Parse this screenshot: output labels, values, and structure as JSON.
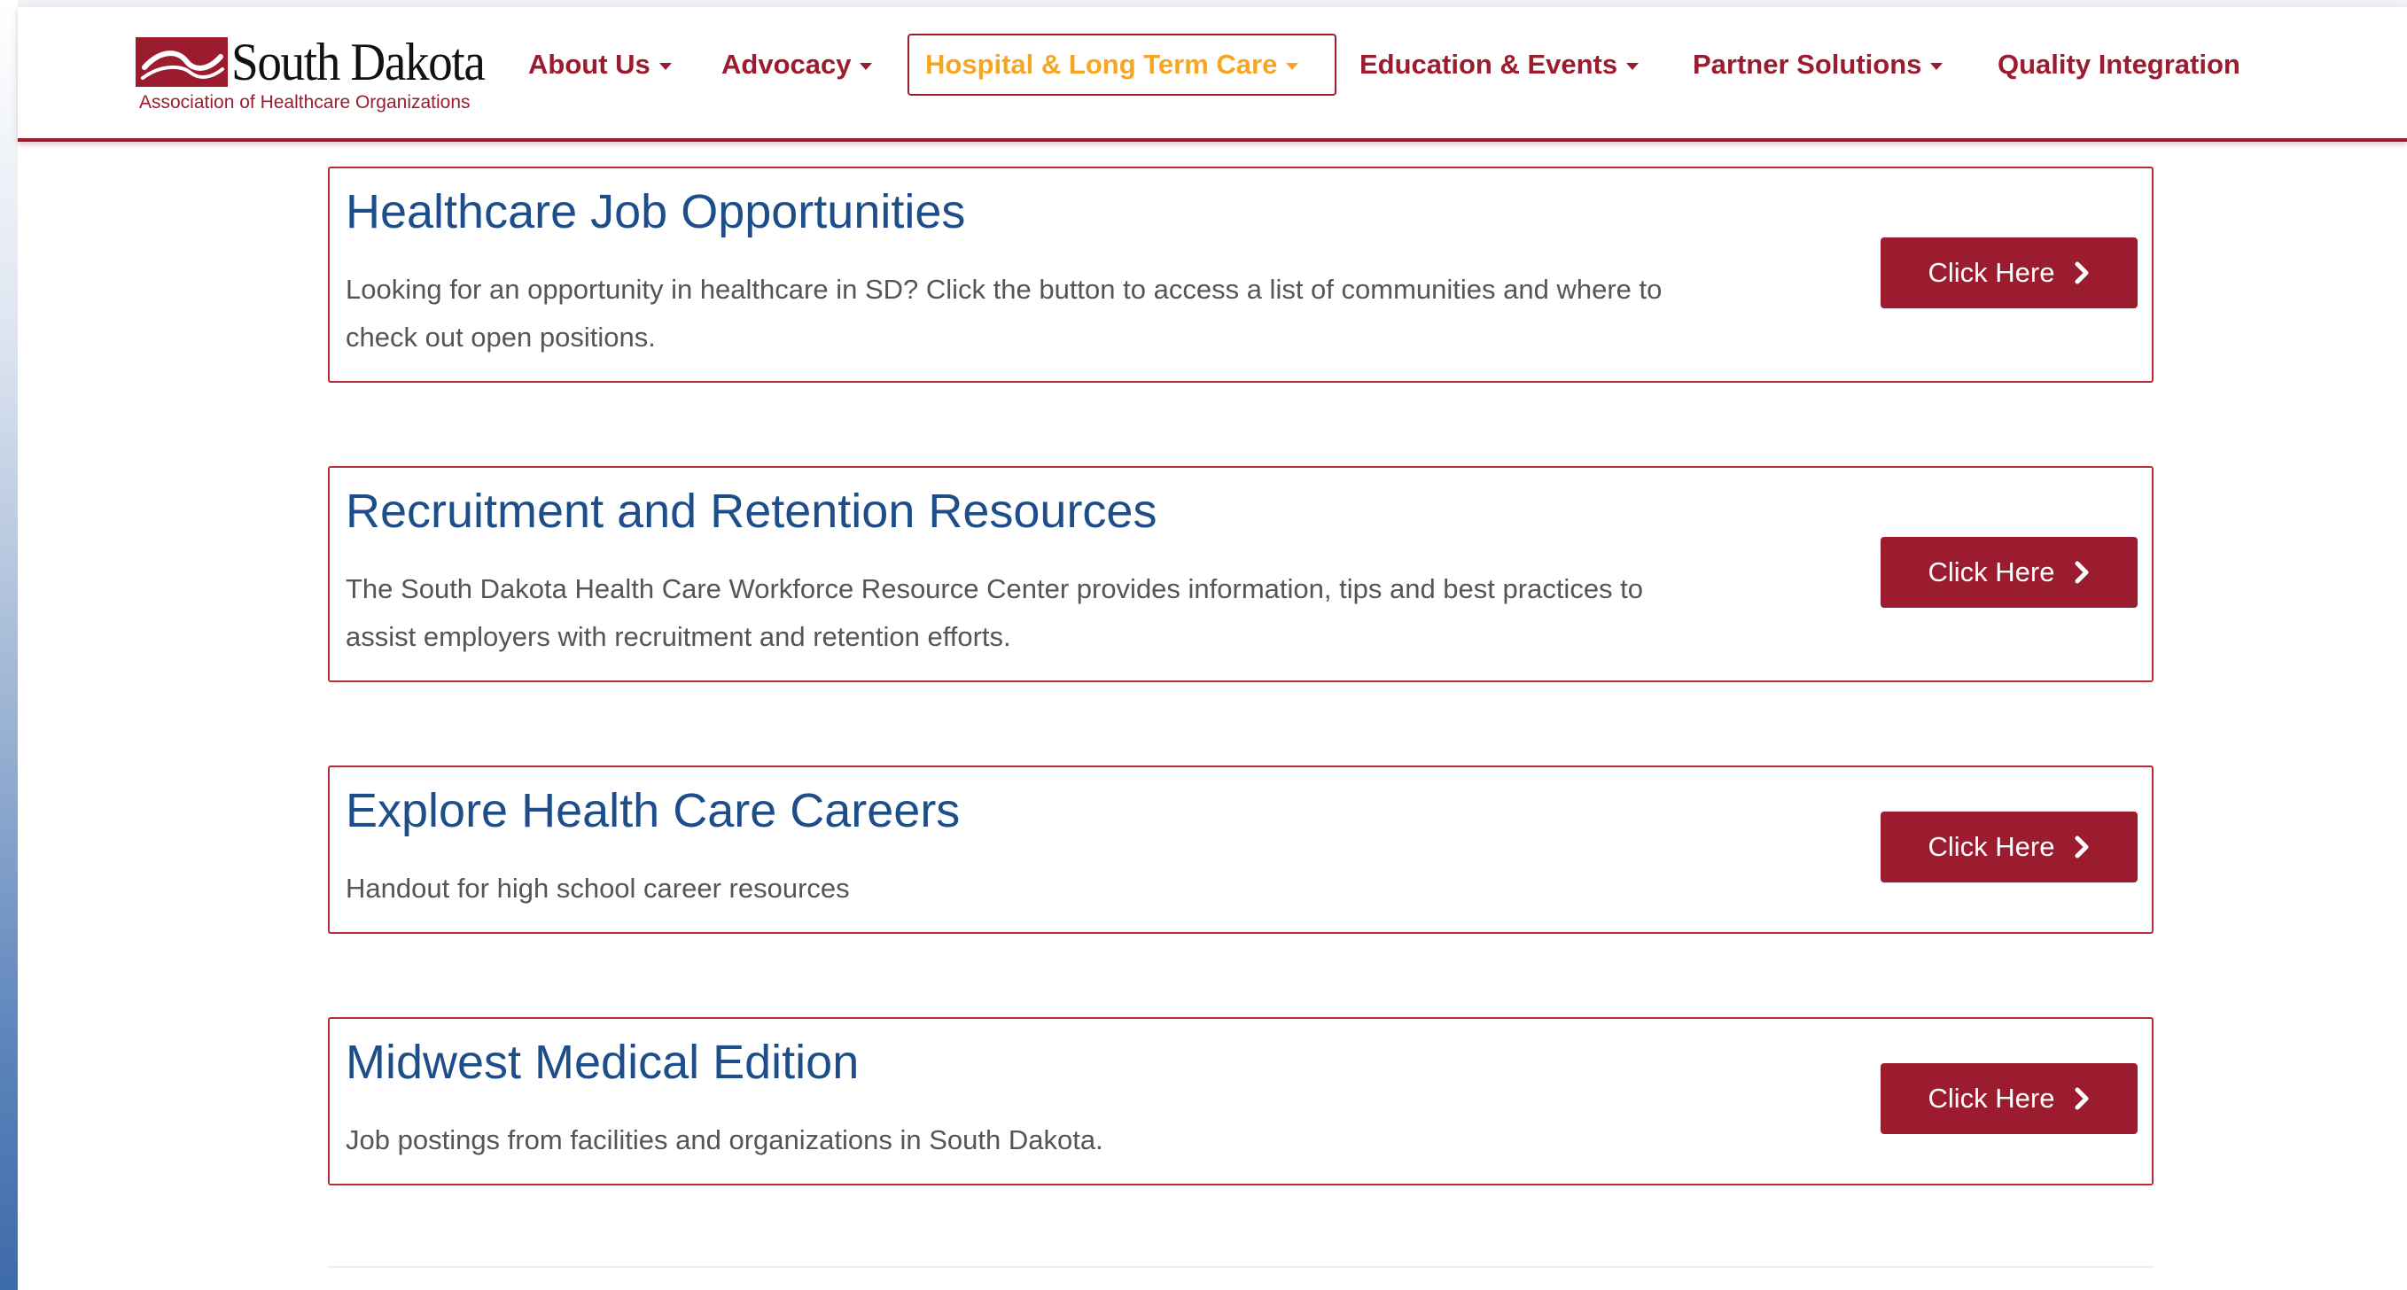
{
  "logo": {
    "name": "South Dakota",
    "subtitle": "Association of Healthcare Organizations"
  },
  "nav": {
    "items": [
      {
        "label": "About Us",
        "has_dropdown": true
      },
      {
        "label": "Advocacy",
        "has_dropdown": true
      },
      {
        "label": "Hospital & Long Term Care",
        "has_dropdown": true,
        "active": true
      },
      {
        "label": "Education & Events",
        "has_dropdown": true
      },
      {
        "label": "Partner Solutions",
        "has_dropdown": true
      },
      {
        "label": "Quality Integration",
        "has_dropdown": false
      }
    ]
  },
  "cards": [
    {
      "title": "Healthcare Job Opportunities",
      "description": "Looking for an opportunity in healthcare in SD? Click the button to access a list of communities and where to check out open positions.",
      "button_label": "Click Here"
    },
    {
      "title": "Recruitment and Retention Resources",
      "description": "The South Dakota Health Care Workforce Resource Center provides information, tips and best practices to assist employers with recruitment and retention efforts.",
      "button_label": "Click Here"
    },
    {
      "title": "Explore Health Care Careers",
      "description": "Handout for high school career resources",
      "button_label": "Click Here"
    },
    {
      "title": "Midwest Medical Edition",
      "description": "Job postings from facilities and organizations in South Dakota.",
      "button_label": "Click Here"
    }
  ],
  "colors": {
    "brand_red": "#9b1c2e",
    "active_nav": "#f5a623",
    "title_blue": "#1d4e89",
    "text_gray": "#555555"
  },
  "icons": {
    "logo_mark": "sd-logo-icon",
    "nav_caret": "caret-down-icon",
    "button_chevron": "chevron-right-icon"
  }
}
